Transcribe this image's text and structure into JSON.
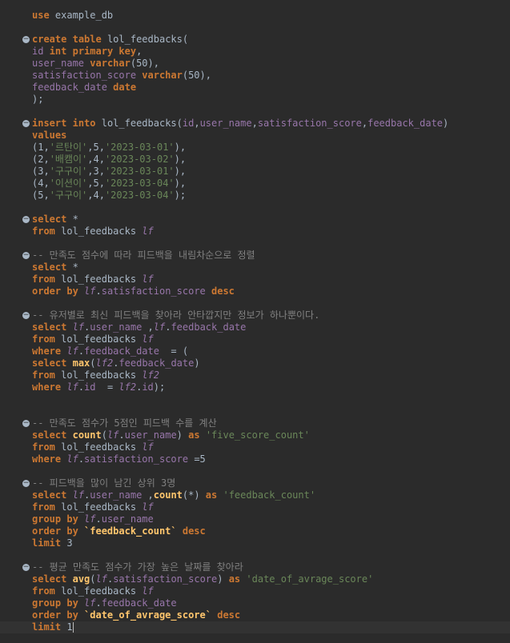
{
  "editor": {
    "lines": [
      [
        {
          "t": "use",
          "c": "kw"
        },
        {
          "t": " example_db",
          "c": "id"
        }
      ],
      [],
      [
        {
          "t": "create",
          "c": "kw"
        },
        {
          "t": " ",
          "c": "id"
        },
        {
          "t": "table",
          "c": "kw"
        },
        {
          "t": " lol_feedbacks(",
          "c": "id"
        }
      ],
      [
        {
          "t": "id",
          "c": "col"
        },
        {
          "t": " ",
          "c": "id"
        },
        {
          "t": "int",
          "c": "kw"
        },
        {
          "t": " ",
          "c": "id"
        },
        {
          "t": "primary key",
          "c": "kw"
        },
        {
          "t": ",",
          "c": "id"
        }
      ],
      [
        {
          "t": "user_name",
          "c": "col"
        },
        {
          "t": " ",
          "c": "id"
        },
        {
          "t": "varchar",
          "c": "kw"
        },
        {
          "t": "(50),",
          "c": "id"
        }
      ],
      [
        {
          "t": "satisfaction_score",
          "c": "col"
        },
        {
          "t": " ",
          "c": "id"
        },
        {
          "t": "varchar",
          "c": "kw"
        },
        {
          "t": "(50),",
          "c": "id"
        }
      ],
      [
        {
          "t": "feedback_date",
          "c": "col"
        },
        {
          "t": " ",
          "c": "id"
        },
        {
          "t": "date",
          "c": "kw"
        }
      ],
      [
        {
          "t": ");",
          "c": "id"
        }
      ],
      [],
      [
        {
          "t": "insert",
          "c": "kw"
        },
        {
          "t": " ",
          "c": "id"
        },
        {
          "t": "into",
          "c": "kw"
        },
        {
          "t": " lol_feedbacks(",
          "c": "id"
        },
        {
          "t": "id",
          "c": "col"
        },
        {
          "t": ",",
          "c": "id"
        },
        {
          "t": "user_name",
          "c": "col"
        },
        {
          "t": ",",
          "c": "id"
        },
        {
          "t": "satisfaction_score",
          "c": "col"
        },
        {
          "t": ",",
          "c": "id"
        },
        {
          "t": "feedback_date",
          "c": "col"
        },
        {
          "t": ")",
          "c": "id"
        }
      ],
      [
        {
          "t": "values",
          "c": "kw"
        }
      ],
      [
        {
          "t": "(1,",
          "c": "id"
        },
        {
          "t": "'르탄이'",
          "c": "str"
        },
        {
          "t": ",5,",
          "c": "id"
        },
        {
          "t": "'2023-03-01'",
          "c": "str"
        },
        {
          "t": "),",
          "c": "id"
        }
      ],
      [
        {
          "t": "(2,",
          "c": "id"
        },
        {
          "t": "'배캠이'",
          "c": "str"
        },
        {
          "t": ",4,",
          "c": "id"
        },
        {
          "t": "'2023-03-02'",
          "c": "str"
        },
        {
          "t": "),",
          "c": "id"
        }
      ],
      [
        {
          "t": "(3,",
          "c": "id"
        },
        {
          "t": "'구구이'",
          "c": "str"
        },
        {
          "t": ",3,",
          "c": "id"
        },
        {
          "t": "'2023-03-01'",
          "c": "str"
        },
        {
          "t": "),",
          "c": "id"
        }
      ],
      [
        {
          "t": "(4,",
          "c": "id"
        },
        {
          "t": "'이션이'",
          "c": "str"
        },
        {
          "t": ",5,",
          "c": "id"
        },
        {
          "t": "'2023-03-04'",
          "c": "str"
        },
        {
          "t": "),",
          "c": "id"
        }
      ],
      [
        {
          "t": "(5,",
          "c": "id"
        },
        {
          "t": "'구구이'",
          "c": "str"
        },
        {
          "t": ",4,",
          "c": "id"
        },
        {
          "t": "'2023-03-04'",
          "c": "str"
        },
        {
          "t": ");",
          "c": "id"
        }
      ],
      [],
      [
        {
          "t": "select",
          "c": "kw"
        },
        {
          "t": " *",
          "c": "id"
        }
      ],
      [
        {
          "t": "from",
          "c": "kw"
        },
        {
          "t": " lol_feedbacks ",
          "c": "id"
        },
        {
          "t": "lf",
          "c": "al"
        }
      ],
      [],
      [
        {
          "t": "-- 만족도 점수에 따라 피드백을 내림차순으로 정렬",
          "c": "cmt"
        }
      ],
      [
        {
          "t": "select",
          "c": "kw"
        },
        {
          "t": " *",
          "c": "id"
        }
      ],
      [
        {
          "t": "from",
          "c": "kw"
        },
        {
          "t": " lol_feedbacks ",
          "c": "id"
        },
        {
          "t": "lf",
          "c": "al"
        }
      ],
      [
        {
          "t": "order by",
          "c": "kw"
        },
        {
          "t": " ",
          "c": "id"
        },
        {
          "t": "lf",
          "c": "al"
        },
        {
          "t": ".",
          "c": "id"
        },
        {
          "t": "satisfaction_score",
          "c": "col"
        },
        {
          "t": " ",
          "c": "id"
        },
        {
          "t": "desc",
          "c": "kw"
        }
      ],
      [],
      [
        {
          "t": "-- 유저별로 최신 피드백을 찾아라 안타깝지만 정보가 하나뿐이다.",
          "c": "cmt"
        }
      ],
      [
        {
          "t": "select",
          "c": "kw"
        },
        {
          "t": " ",
          "c": "id"
        },
        {
          "t": "lf",
          "c": "al"
        },
        {
          "t": ".",
          "c": "id"
        },
        {
          "t": "user_name",
          "c": "col"
        },
        {
          "t": " ,",
          "c": "id"
        },
        {
          "t": "lf",
          "c": "al"
        },
        {
          "t": ".",
          "c": "id"
        },
        {
          "t": "feedback_date",
          "c": "col"
        }
      ],
      [
        {
          "t": "from",
          "c": "kw"
        },
        {
          "t": " lol_feedbacks ",
          "c": "id"
        },
        {
          "t": "lf",
          "c": "al"
        }
      ],
      [
        {
          "t": "where",
          "c": "kw"
        },
        {
          "t": " ",
          "c": "id"
        },
        {
          "t": "lf",
          "c": "al"
        },
        {
          "t": ".",
          "c": "id"
        },
        {
          "t": "feedback_date",
          "c": "col"
        },
        {
          "t": "  = (",
          "c": "id"
        }
      ],
      [
        {
          "t": "select",
          "c": "kw"
        },
        {
          "t": " ",
          "c": "id"
        },
        {
          "t": "max",
          "c": "fn"
        },
        {
          "t": "(",
          "c": "id"
        },
        {
          "t": "lf2",
          "c": "al"
        },
        {
          "t": ".",
          "c": "id"
        },
        {
          "t": "feedback_date",
          "c": "col"
        },
        {
          "t": ")",
          "c": "id"
        }
      ],
      [
        {
          "t": "from",
          "c": "kw"
        },
        {
          "t": " lol_feedbacks ",
          "c": "id"
        },
        {
          "t": "lf2",
          "c": "al"
        }
      ],
      [
        {
          "t": "where",
          "c": "kw"
        },
        {
          "t": " ",
          "c": "id"
        },
        {
          "t": "lf",
          "c": "al"
        },
        {
          "t": ".",
          "c": "id"
        },
        {
          "t": "id",
          "c": "col"
        },
        {
          "t": "  = ",
          "c": "id"
        },
        {
          "t": "lf2",
          "c": "al"
        },
        {
          "t": ".",
          "c": "id"
        },
        {
          "t": "id",
          "c": "col"
        },
        {
          "t": ");",
          "c": "id"
        }
      ],
      [],
      [],
      [
        {
          "t": "-- 만족도 점수가 5점인 피드백 수를 계산",
          "c": "cmt"
        }
      ],
      [
        {
          "t": "select",
          "c": "kw"
        },
        {
          "t": " ",
          "c": "id"
        },
        {
          "t": "count",
          "c": "fn"
        },
        {
          "t": "(",
          "c": "id"
        },
        {
          "t": "lf",
          "c": "al"
        },
        {
          "t": ".",
          "c": "id"
        },
        {
          "t": "user_name",
          "c": "col"
        },
        {
          "t": ") ",
          "c": "id"
        },
        {
          "t": "as",
          "c": "kw"
        },
        {
          "t": " ",
          "c": "id"
        },
        {
          "t": "'five_score_count'",
          "c": "str"
        }
      ],
      [
        {
          "t": "from",
          "c": "kw"
        },
        {
          "t": " lol_feedbacks ",
          "c": "id"
        },
        {
          "t": "lf",
          "c": "al"
        }
      ],
      [
        {
          "t": "where",
          "c": "kw"
        },
        {
          "t": " ",
          "c": "id"
        },
        {
          "t": "lf",
          "c": "al"
        },
        {
          "t": ".",
          "c": "id"
        },
        {
          "t": "satisfaction_score",
          "c": "col"
        },
        {
          "t": " =5",
          "c": "id"
        }
      ],
      [],
      [
        {
          "t": "-- 피드백을 많이 남긴 상위 3명",
          "c": "cmt"
        }
      ],
      [
        {
          "t": "select",
          "c": "kw"
        },
        {
          "t": " ",
          "c": "id"
        },
        {
          "t": "lf",
          "c": "al"
        },
        {
          "t": ".",
          "c": "id"
        },
        {
          "t": "user_name",
          "c": "col"
        },
        {
          "t": " ,",
          "c": "id"
        },
        {
          "t": "count",
          "c": "fn"
        },
        {
          "t": "(*) ",
          "c": "id"
        },
        {
          "t": "as",
          "c": "kw"
        },
        {
          "t": " ",
          "c": "id"
        },
        {
          "t": "'feedback_count'",
          "c": "str"
        }
      ],
      [
        {
          "t": "from",
          "c": "kw"
        },
        {
          "t": " lol_feedbacks ",
          "c": "id"
        },
        {
          "t": "lf",
          "c": "al"
        }
      ],
      [
        {
          "t": "group by",
          "c": "kw"
        },
        {
          "t": " ",
          "c": "id"
        },
        {
          "t": "lf",
          "c": "al"
        },
        {
          "t": ".",
          "c": "id"
        },
        {
          "t": "user_name",
          "c": "col"
        }
      ],
      [
        {
          "t": "order by",
          "c": "kw"
        },
        {
          "t": " ",
          "c": "id"
        },
        {
          "t": "`feedback_count`",
          "c": "fn"
        },
        {
          "t": " ",
          "c": "id"
        },
        {
          "t": "desc",
          "c": "kw"
        }
      ],
      [
        {
          "t": "limit",
          "c": "kw"
        },
        {
          "t": " 3",
          "c": "id"
        }
      ],
      [],
      [
        {
          "t": "-- 평균 만족도 점수가 가장 높은 날짜를 찾아라",
          "c": "cmt"
        }
      ],
      [
        {
          "t": "select",
          "c": "kw"
        },
        {
          "t": " ",
          "c": "id"
        },
        {
          "t": "avg",
          "c": "fn"
        },
        {
          "t": "(",
          "c": "id"
        },
        {
          "t": "lf",
          "c": "al"
        },
        {
          "t": ".",
          "c": "id"
        },
        {
          "t": "satisfaction_score",
          "c": "col"
        },
        {
          "t": ") ",
          "c": "id"
        },
        {
          "t": "as",
          "c": "kw"
        },
        {
          "t": " ",
          "c": "id"
        },
        {
          "t": "'date_of_avrage_score'",
          "c": "str"
        }
      ],
      [
        {
          "t": "from",
          "c": "kw"
        },
        {
          "t": " lol_feedbacks ",
          "c": "id"
        },
        {
          "t": "lf",
          "c": "al"
        }
      ],
      [
        {
          "t": "group by",
          "c": "kw"
        },
        {
          "t": " ",
          "c": "id"
        },
        {
          "t": "lf",
          "c": "al"
        },
        {
          "t": ".",
          "c": "id"
        },
        {
          "t": "feedback_date",
          "c": "col"
        }
      ],
      [
        {
          "t": "order by",
          "c": "kw"
        },
        {
          "t": " ",
          "c": "id"
        },
        {
          "t": "`date_of_avrage_score`",
          "c": "fn"
        },
        {
          "t": " ",
          "c": "id"
        },
        {
          "t": "desc",
          "c": "kw"
        }
      ],
      [
        {
          "t": "limit",
          "c": "kw"
        },
        {
          "t": " 1",
          "c": "id"
        }
      ]
    ],
    "fold_lines": [
      2,
      9,
      17,
      20,
      25,
      34,
      39,
      46
    ],
    "current_line": 51,
    "fold_glyph": "−",
    "colors": {
      "background": "#2b2b2b",
      "keyword": "#cc7832",
      "column": "#9876aa",
      "string": "#6a8759",
      "function": "#ffc66d",
      "comment": "#808080",
      "default": "#a9b7c6"
    }
  }
}
